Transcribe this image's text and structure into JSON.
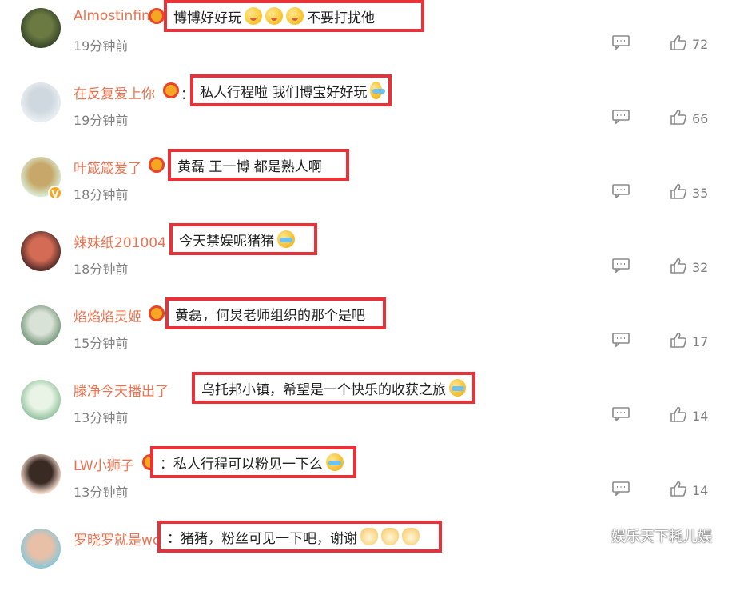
{
  "comments": [
    {
      "name": "Almostinfin",
      "text": "博博好好玩",
      "extra": "不要打扰他",
      "emojis": [
        "face",
        "face",
        "face"
      ],
      "time": "19分钟前",
      "likes": "72",
      "colon": "："
    },
    {
      "name": "在反复爱上你",
      "text": "私人行程啦 我们博宝好好玩",
      "extra": "",
      "emojis": [
        "cry"
      ],
      "time": "19分钟前",
      "likes": "66",
      "colon": "："
    },
    {
      "name": "叶箴箴爱了",
      "text": "黄磊 王一博 都是熟人啊",
      "extra": "",
      "emojis": [],
      "time": "18分钟前",
      "likes": "35",
      "colon": ""
    },
    {
      "name": "辣妹纸201004",
      "text": "今天禁娱呢猪猪",
      "extra": "",
      "emojis": [
        "cry"
      ],
      "time": "18分钟前",
      "likes": "32",
      "colon": ""
    },
    {
      "name": "焰焰焰灵姬",
      "text": "黄磊，何炅老师组织的那个是吧",
      "extra": "",
      "emojis": [],
      "time": "15分钟前",
      "likes": "17",
      "colon": ""
    },
    {
      "name": "滕净今天播出了吗",
      "text": "乌托邦小镇，希望是一个快乐的收获之旅",
      "extra": "",
      "emojis": [
        "cry"
      ],
      "time": "13分钟前",
      "likes": "14",
      "colon": ""
    },
    {
      "name": "LW小狮子",
      "text": "：私人行程可以粉见一下么",
      "extra": "",
      "emojis": [
        "cry"
      ],
      "time": "13分钟前",
      "likes": "14",
      "colon": ""
    },
    {
      "name": "罗晓罗就是wc",
      "text": "：猪猪，粉丝可见一下吧，谢谢",
      "extra": "",
      "emojis": [
        "cat",
        "cat",
        "cat"
      ],
      "time": "",
      "likes": "",
      "colon": ""
    }
  ],
  "watermark": "娱乐天下耗儿娱",
  "colors": {
    "name": "#eb7350",
    "highlight": "#e8323a",
    "meta": "#808080"
  },
  "icons": {
    "reply": "comment-icon",
    "like": "thumbs-up-icon",
    "badge": "vip-badge-icon"
  }
}
